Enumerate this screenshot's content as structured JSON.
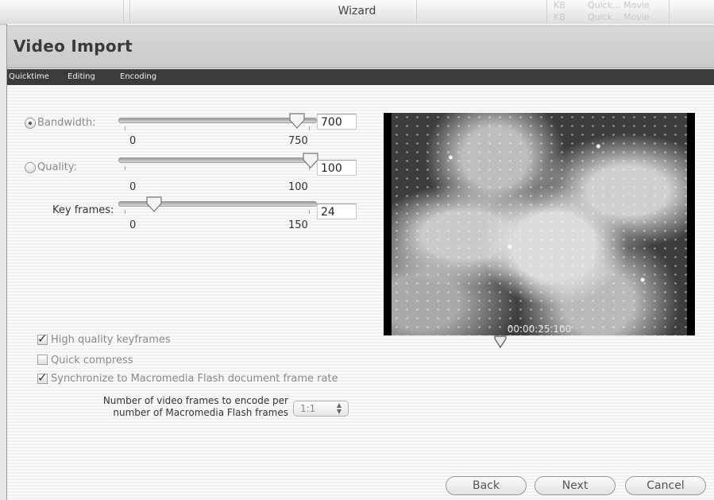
{
  "titlebar": {
    "title": "Wizard",
    "ghost_1": "KB",
    "ghost_2": "KB",
    "ghost_3": "Quick... Movie",
    "ghost_4": "Quick... Movie"
  },
  "header": {
    "title": "Video Import"
  },
  "tabs": [
    {
      "label": "Quicktime"
    },
    {
      "label": "Editing"
    },
    {
      "label": "Encoding"
    }
  ],
  "settings": {
    "bandwidth": {
      "label": "Bandwidth:",
      "value": "700",
      "min": "0",
      "max": "750",
      "selected": true
    },
    "quality": {
      "label": "Quality:",
      "value": "100",
      "min": "0",
      "max": "100",
      "selected": false
    },
    "keyframes": {
      "label": "Key frames:",
      "value": "24",
      "min": "0",
      "max": "150"
    }
  },
  "preview": {
    "timecode": "00:00:25.100"
  },
  "options": {
    "high_quality": {
      "label": "High quality keyframes",
      "checked": true
    },
    "quick_compress": {
      "label": "Quick compress",
      "checked": false
    },
    "sync": {
      "label": "Synchronize to Macromedia Flash document frame rate",
      "checked": true
    }
  },
  "frame_ratio": {
    "label_line1": "Number of video frames to encode per",
    "label_line2": "number of Macromedia Flash frames",
    "value": "1:1"
  },
  "buttons": {
    "back": "Back",
    "next": "Next",
    "cancel": "Cancel"
  },
  "icons": {
    "check": "✓",
    "stepper": "up-down-arrows"
  }
}
